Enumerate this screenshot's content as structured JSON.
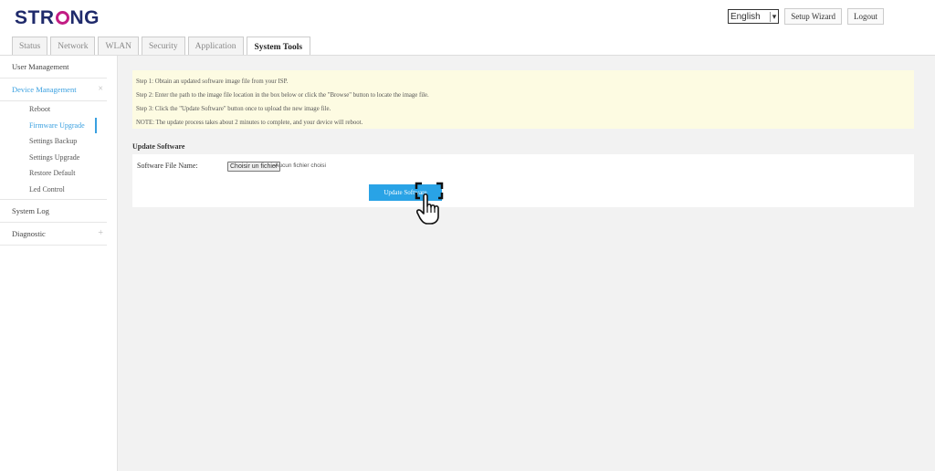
{
  "brand": {
    "logo_left": "STR",
    "logo_right": "NG"
  },
  "header": {
    "language": "English",
    "setup_wizard": "Setup Wizard",
    "logout": "Logout"
  },
  "tabs": [
    {
      "label": "Status"
    },
    {
      "label": "Network"
    },
    {
      "label": "WLAN"
    },
    {
      "label": "Security"
    },
    {
      "label": "Application"
    },
    {
      "label": "System Tools"
    }
  ],
  "active_tab": "System Tools",
  "sidebar": {
    "user_management": "User Management",
    "device_management": "Device Management",
    "device_management_mark": "×",
    "sub_items": [
      {
        "label": "Reboot"
      },
      {
        "label": "Firmware Upgrade"
      },
      {
        "label": "Settings Backup"
      },
      {
        "label": "Settings Upgrade"
      },
      {
        "label": "Restore Default"
      },
      {
        "label": "Led Control"
      }
    ],
    "system_log": "System Log",
    "diagnostic": "Diagnostic",
    "diagnostic_mark": "+"
  },
  "notice": {
    "step1": "Step 1: Obtain an updated software image file from your ISP.",
    "step2": "Step 2: Enter the path to the image file location in the box below or click the \"Browse\" button to locate the image file.",
    "step3": "Step 3: Click the \"Update Software\" button once to upload the new image file.",
    "note": "NOTE: The update process takes about 2 minutes to complete, and your device will reboot."
  },
  "update": {
    "section_title": "Update Software",
    "field_label": "Software File Name:",
    "file_button": "Choisir un fichier",
    "file_status": "Aucun fichier choisi",
    "submit": "Update Software"
  },
  "colors": {
    "accent": "#29a3e6",
    "brand_blue": "#1f2a6b",
    "brand_magenta": "#c21d84",
    "notice_bg": "#fdfbe2"
  }
}
